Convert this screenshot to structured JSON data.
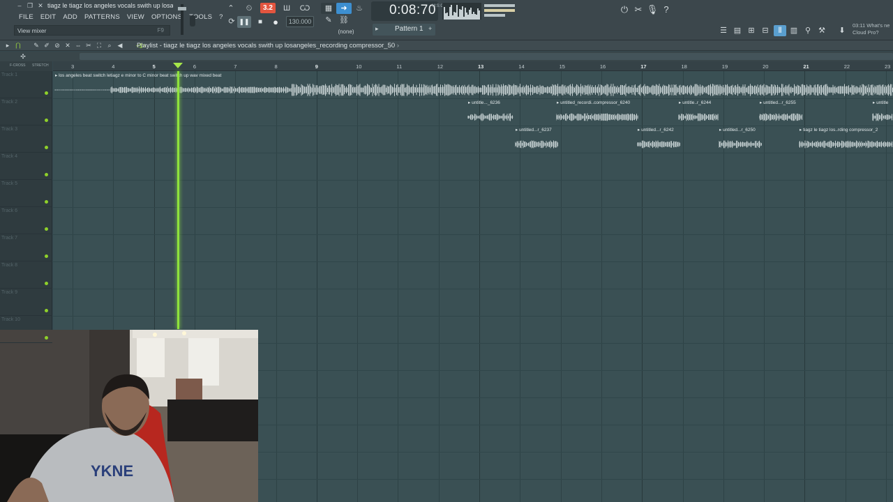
{
  "window": {
    "project_title": "tiagz le tiagz los angeles vocals swith up losan.",
    "menu": [
      "FILE",
      "EDIT",
      "ADD",
      "PATTERNS",
      "VIEW",
      "OPTIONS",
      "TOOLS",
      "?"
    ],
    "hint_text": "View mixer",
    "hint_key": "F9"
  },
  "transport": {
    "pattern_song_indicator": "3.2",
    "tempo": "130.000",
    "time": "0:08:70",
    "time_unit": "M:S:CS",
    "snap": "(none)",
    "pattern": "Pattern 1"
  },
  "news": {
    "line1": "03:11  What's ne",
    "line2": "Cloud Pro?"
  },
  "playlist": {
    "title": "Playlist - tiagz le tiagz los angeles vocals swith up losangeles_recording compressor_50",
    "header_left": "F-CROSS",
    "header_right": "STRETCH",
    "bars": [
      "3",
      "4",
      "5",
      "6",
      "7",
      "8",
      "9",
      "10",
      "11",
      "12",
      "13",
      "14",
      "15",
      "16",
      "17",
      "18",
      "19",
      "20",
      "21",
      "22",
      "23"
    ],
    "tracks": [
      "Track 1",
      "Track 2",
      "Track 3",
      "Track 4",
      "Track 5",
      "Track 6",
      "Track 7",
      "Track 8",
      "Track 9",
      "Track 10"
    ],
    "clips": [
      {
        "track": 0,
        "label": "los angeles beat switch letiagz e minor to C minor beat switch up wav mixed beat"
      },
      {
        "track": 1,
        "label": "untitle..._6236"
      },
      {
        "track": 1,
        "label": "untitled_recordi..compressor_6240"
      },
      {
        "track": 1,
        "label": "untitle..r_6244"
      },
      {
        "track": 1,
        "label": "untitled...r_6255"
      },
      {
        "track": 1,
        "label": "untitle"
      },
      {
        "track": 2,
        "label": "untitled...r_6237"
      },
      {
        "track": 2,
        "label": "untitled...r_6242"
      },
      {
        "track": 2,
        "label": "untitled...r_6250"
      },
      {
        "track": 2,
        "label": "tiagz le tiagz los..rding compressor_2"
      }
    ]
  },
  "colors": {
    "accent": "#8fe33c",
    "grid_bg": "#3a5054",
    "record_mode": "#e3553f",
    "active_icon": "#5a9fcf"
  }
}
